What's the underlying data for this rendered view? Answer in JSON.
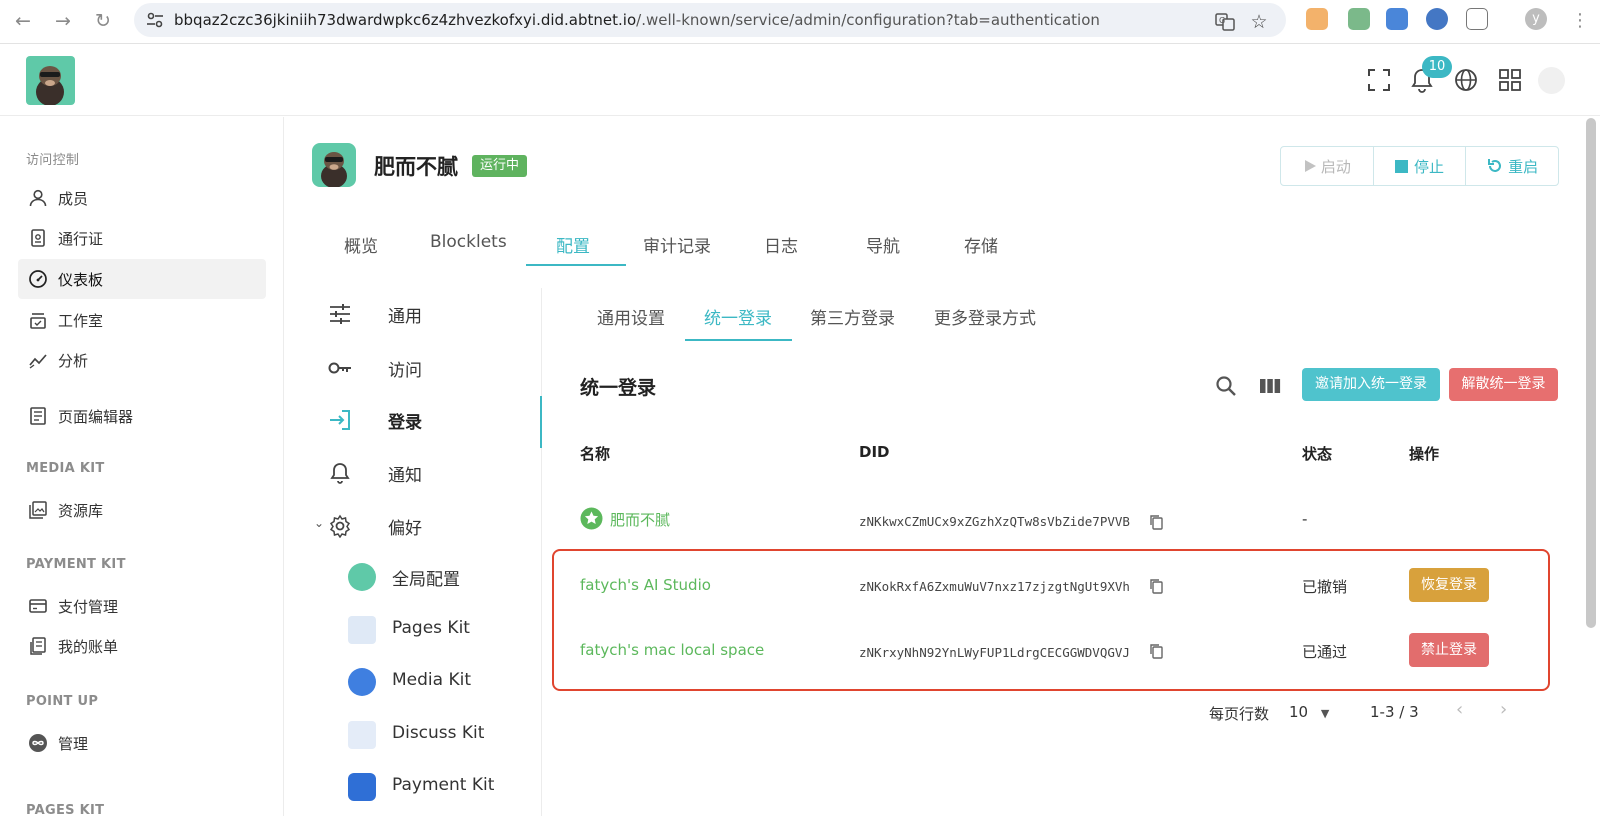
{
  "browser": {
    "url_host": "bbqaz2czc36jkiniih73dwardwpkc6z4zhvezkofxyi.did.abtnet.io",
    "url_path": "/.well-known/service/admin/configuration?tab=authentication",
    "profile_letter": "y"
  },
  "header": {
    "notification_count": "10"
  },
  "sidebar": {
    "sections": [
      {
        "title": "访问控制",
        "items": [
          "成员",
          "通行证",
          "仪表板",
          "工作室",
          "分析"
        ]
      },
      {
        "title": "",
        "items": [
          "页面编辑器"
        ]
      },
      {
        "title": "MEDIA KIT",
        "items": [
          "资源库"
        ]
      },
      {
        "title": "PAYMENT KIT",
        "items": [
          "支付管理",
          "我的账单"
        ]
      },
      {
        "title": "POINT UP",
        "items": [
          "管理"
        ]
      },
      {
        "title": "PAGES KIT",
        "items": []
      }
    ],
    "active_item": "仪表板"
  },
  "app": {
    "name": "肥而不腻",
    "status": "运行中",
    "actions": {
      "start": "启动",
      "stop": "停止",
      "restart": "重启"
    }
  },
  "tabs": [
    "概览",
    "Blocklets",
    "配置",
    "审计记录",
    "日志",
    "导航",
    "存储"
  ],
  "active_tab": "配置",
  "config_nav": {
    "items": [
      "通用",
      "访问",
      "登录",
      "通知",
      "偏好"
    ],
    "active": "登录",
    "sub_items": [
      "全局配置",
      "Pages Kit",
      "Media Kit",
      "Discuss Kit",
      "Payment Kit"
    ]
  },
  "inner_tabs": [
    "通用设置",
    "统一登录",
    "第三方登录",
    "更多登录方式"
  ],
  "active_inner_tab": "统一登录",
  "panel": {
    "title": "统一登录",
    "invite_button": "邀请加入统一登录",
    "dissolve_button": "解散统一登录"
  },
  "table": {
    "columns": [
      "名称",
      "DID",
      "状态",
      "操作"
    ],
    "rows": [
      {
        "name": "肥而不腻",
        "did": "zNKkwxCZmUCx9xZGzhXzQTw8sVbZide7PVVB",
        "status": "-",
        "action": ""
      },
      {
        "name": "fatych's AI Studio",
        "did": "zNKokRxfA6ZxmuWuV7nxz17zjzgtNgUt9XVh",
        "status": "已撤销",
        "action": "恢复登录"
      },
      {
        "name": "fatych's mac local space",
        "did": "zNKrxyNhN92YnLWyFUP1LdrgCECGGWDVQGVJ",
        "status": "已通过",
        "action": "禁止登录"
      }
    ]
  },
  "pagination": {
    "rows_per_page_label": "每页行数",
    "rows_per_page": "10",
    "range": "1-3 / 3"
  },
  "colors": {
    "accent": "#3cb8c4",
    "success_text": "#5cb85c",
    "danger": "#e26d6d",
    "warning": "#d8a13c",
    "running_badge": "#5fb35f",
    "highlight": "#e0452f"
  }
}
